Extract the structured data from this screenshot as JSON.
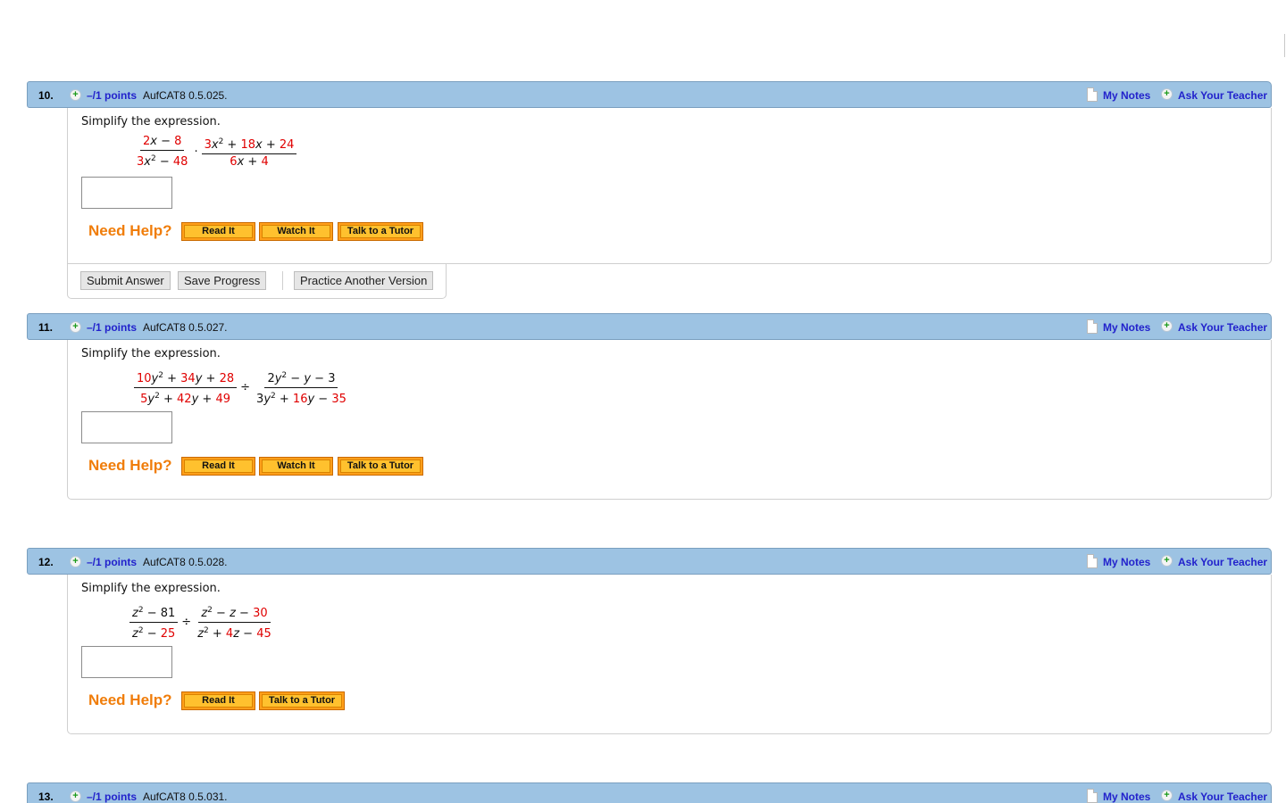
{
  "common": {
    "prompt": "Simplify the expression.",
    "need_help": "Need Help?",
    "my_notes": "My Notes",
    "ask_teacher": "Ask Your Teacher",
    "plus_glyph": "+",
    "icons": {
      "points": "plus-circle-icon",
      "notes": "note-page-icon",
      "ask": "plus-circle-icon"
    }
  },
  "questions": [
    {
      "number": "10.",
      "points": "–/1 points",
      "code": "AufCAT8 0.5.025.",
      "expression": {
        "left_num": [
          "2",
          "x",
          " − ",
          "8"
        ],
        "left_den": [
          "3",
          "x",
          "2",
          " − ",
          "48"
        ],
        "operator": "·",
        "right_num": [
          "3",
          "x",
          "2",
          " + ",
          "18",
          "x",
          " + ",
          "24"
        ],
        "right_den": [
          "6",
          "x",
          " + ",
          "4"
        ]
      },
      "answer_value": "",
      "help_buttons": [
        "Read It",
        "Watch It",
        "Talk to a Tutor"
      ],
      "actions": [
        "Submit Answer",
        "Save Progress",
        "Practice Another Version"
      ]
    },
    {
      "number": "11.",
      "points": "–/1 points",
      "code": "AufCAT8 0.5.027.",
      "expression": {
        "left_num": [
          "10",
          "y",
          "2",
          " + ",
          "34",
          "y",
          " + ",
          "28"
        ],
        "left_den": [
          "5",
          "y",
          "2",
          " + ",
          "42",
          "y",
          " + ",
          "49"
        ],
        "operator": "÷",
        "right_num": [
          "2",
          "y",
          "2",
          " − ",
          "y",
          " − ",
          "3"
        ],
        "right_den": [
          "3",
          "y",
          "2",
          " + ",
          "16",
          "y",
          " − ",
          "35"
        ]
      },
      "answer_value": "",
      "help_buttons": [
        "Read It",
        "Watch It",
        "Talk to a Tutor"
      ]
    },
    {
      "number": "12.",
      "points": "–/1 points",
      "code": "AufCAT8 0.5.028.",
      "expression": {
        "left_num": [
          "z",
          "2",
          " − ",
          "81"
        ],
        "left_den": [
          "z",
          "2",
          " − ",
          "25"
        ],
        "operator": "÷",
        "right_num": [
          "z",
          "2",
          " − ",
          "z",
          " − ",
          "30"
        ],
        "right_den": [
          "z",
          "2",
          " + ",
          "4",
          "z",
          " − ",
          "45"
        ]
      },
      "answer_value": "",
      "help_buttons": [
        "Read It",
        "Talk to a Tutor"
      ]
    },
    {
      "number": "13.",
      "points": "–/1 points",
      "code": "AufCAT8 0.5.031."
    }
  ],
  "colors": {
    "header_bg": "#9dc3e3",
    "link": "#2222cc",
    "need_help": "#f07d0a",
    "coefficient_red": "#e00000",
    "help_button": "#ffc12e"
  }
}
